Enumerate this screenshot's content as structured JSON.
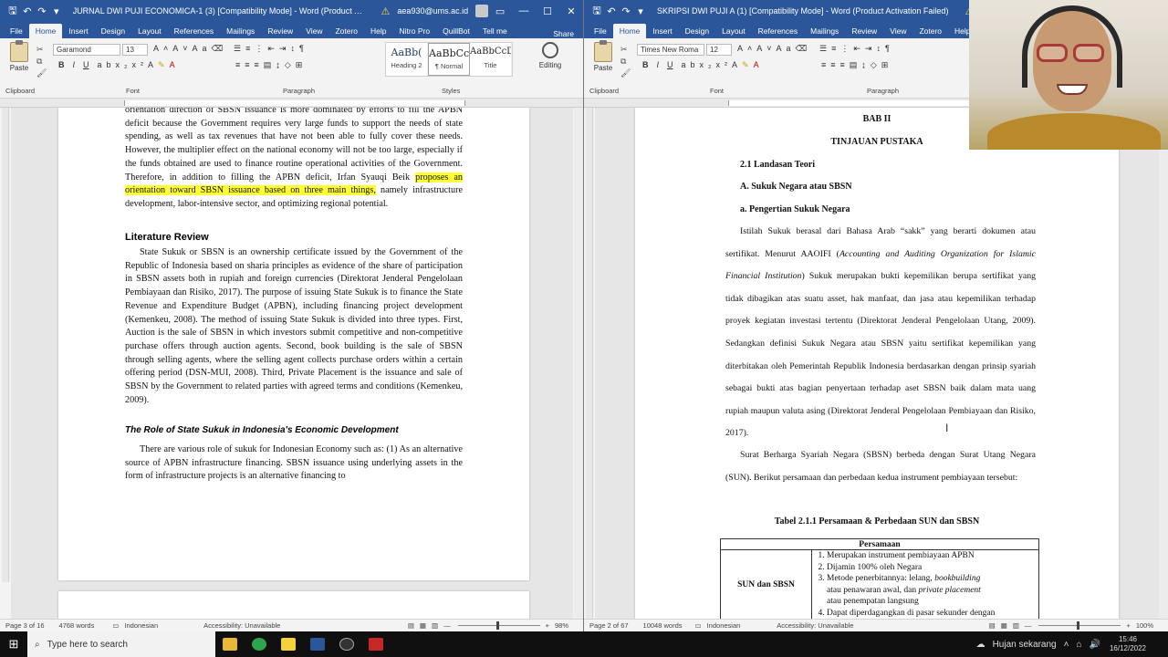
{
  "left_window": {
    "title": "JURNAL DWI PUJI ECONOMICA-1 (3) [Compatibility Mode] - Word (Product A...",
    "account": "aea930@ums.ac.id",
    "tabs": [
      "File",
      "Home",
      "Insert",
      "Design",
      "Layout",
      "References",
      "Mailings",
      "Review",
      "View",
      "Zotero",
      "Help",
      "Nitro Pro",
      "QuillBot",
      "Tell me"
    ],
    "share": "Share",
    "font_name": "Garamond",
    "font_size": "13",
    "groups": {
      "clipboard": "Clipboard",
      "font": "Font",
      "paragraph": "Paragraph",
      "styles": "Styles"
    },
    "paste": "Paste",
    "styles": [
      {
        "sample": "AaBb(",
        "name": "Heading 2"
      },
      {
        "sample": "AaBbCcI",
        "name": "¶ Normal"
      },
      {
        "sample": "AaBbCcDd",
        "name": "Title"
      }
    ],
    "editing": "Editing",
    "doc": {
      "p1_pre": "orientation direction of SBSN issuance is more dominated by efforts to fill the APBN deficit because the Government requires very large funds to support the needs of state spending, as well as tax revenues that have not been able to fully cover these needs. However, the multiplier effect on the national economy will not be too large, especially if the funds obtained are used to finance routine operational activities of the Government. Therefore, in addition to filling the APBN deficit, Irfan Syauqi Beik ",
      "p1_hl": "proposes an orientation toward SBSN issuance based on three main things,",
      "p1_post": " namely infrastructure development, labor-intensive sector, and optimizing regional potential.",
      "lit_heading": "Literature Review",
      "p2": "State Sukuk or SBSN is an ownership certificate issued by the Government of the Republic of Indonesia based on sharia principles as evidence of the share of participation in SBSN assets both in rupiah and foreign currencies (Direktorat Jenderal Pengelolaan Pembiayaan dan Risiko, 2017). The purpose of issuing State Sukuk is to finance the State Revenue and Expenditure Budget (APBN), including financing project development (Kemenkeu, 2008). The method of issuing State Sukuk is divided into three types. First, Auction is the sale of SBSN in which investors submit competitive and non-competitive purchase offers through auction agents. Second, book building is the sale of SBSN through selling agents, where the selling agent collects purchase orders within a certain offering period (DSN-MUI, 2008). Third, Private Placement is the issuance and sale of SBSN by the Government to related parties with agreed terms and conditions (Kemenkeu, 2009).",
      "role_heading": "The Role of State Sukuk in Indonesia's Economic Development",
      "p3": "There are various role of sukuk for Indonesian Economy such as: (1) As an alternative source of APBN infrastructure financing. SBSN issuance using underlying assets in the form of infrastructure projects is an alternative financing to"
    },
    "status": {
      "page": "Page 3 of 16",
      "words": "4768 words",
      "language": "Indonesian",
      "accessibility": "Accessibility: Unavailable",
      "zoom": "98%"
    }
  },
  "right_window": {
    "title": "SKRIPSI DWI PUJI A (1) [Compatibility Mode] - Word (Product Activation Failed)",
    "tabs": [
      "File",
      "Home",
      "Insert",
      "Design",
      "Layout",
      "References",
      "Mailings",
      "Review",
      "View",
      "Zotero",
      "Help"
    ],
    "font_name": "Times New Roma",
    "font_size": "12",
    "paste": "Paste",
    "groups": {
      "clipboard": "Clipboard",
      "font": "Font",
      "paragraph": "Paragraph"
    },
    "doc": {
      "bab": "BAB II",
      "tinjauan": "TINJAUAN PUSTAKA",
      "h21": "2.1 Landasan Teori",
      "hA": "A.  Sukuk Negara atau SBSN",
      "ha": "a.   Pengertian Sukuk Negara",
      "p1": "Istilah Sukuk berasal dari Bahasa Arab “sakk” yang berarti dokumen atau sertifikat. Menurut AAOIFI (",
      "p1_italic": "Accounting and Auditing Organization for Islamic Financial Institution",
      "p1_post": ") Sukuk merupakan bukti kepemilikan berupa sertifikat yang tidak dibagikan atas suatu asset, hak manfaat, dan jasa atau kepemilikan terhadap proyek kegiatan investasi tertentu (Direktorat Jenderal Pengelolaan Utang, 2009). Sedangkan definisi Sukuk Negara atau SBSN yaitu sertifikat kepemilikan yang diterbitakan oleh Pemerintah Republik Indonesia berdasarkan dengan prinsip syariah sebagai bukti atas bagian penyertaan terhadap aset SBSN baik dalam mata uang rupiah maupun valuta asing (Direktorat Jenderal Pengelolaan Pembiayaan dan Risiko, 2017).",
      "p2": "Surat Berharga Syariah Negara (SBSN) berbeda dengan Surat Utang Negara (SUN). Berikut persamaan dan perbedaan kedua instrument pembiayaan tersebut:",
      "table_title": "Tabel 2.1.1 Persamaan & Perbedaan SUN dan SBSN",
      "table_header": "Persamaan",
      "row_label": "SUN dan SBSN",
      "items": [
        "Merupakan instrument pembiayaan APBN",
        "Dijamin 100% oleh Negara",
        "Metode penerbitannya: lelang, ",
        "Dapat diperdagangkan di pasar sekunder dengan"
      ],
      "item3_italic1": "bookbuilding",
      "item3_mid": "atau penawaran awal, dan ",
      "item3_italic2": "private placement",
      "item3_tail": "atau penempatan langsung"
    },
    "status": {
      "page": "Page 2 of 67",
      "words": "10048 words",
      "language": "Indonesian",
      "accessibility": "Accessibility: Unavailable",
      "zoom": "100%"
    }
  },
  "taskbar": {
    "search_placeholder": "Type here to search",
    "weather": "Hujan sekarang",
    "time": "15:46",
    "date": "16/12/2022"
  }
}
